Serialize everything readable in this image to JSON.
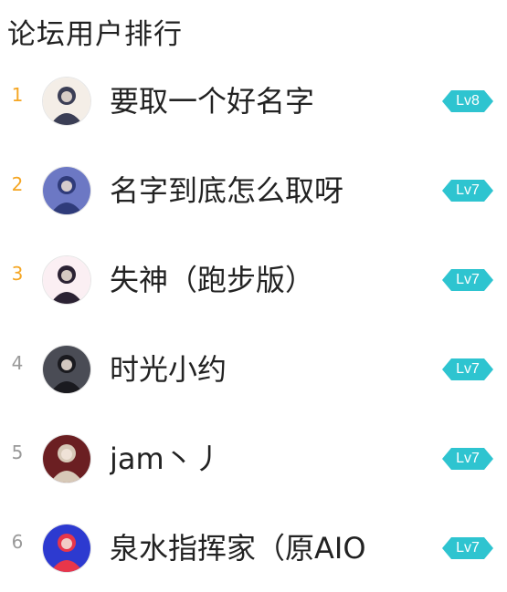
{
  "title": "论坛用户排行",
  "colors": {
    "rank_top": "#f5a623",
    "rank_other": "#999999",
    "badge": "#2ec4d0"
  },
  "users": [
    {
      "rank": "1",
      "name": "要取一个好名字",
      "level": "Lv8",
      "avatar_hue": "#3b3e55",
      "avatar_bg": "#f4eee7"
    },
    {
      "rank": "2",
      "name": "名字到底怎么取呀",
      "level": "Lv7",
      "avatar_hue": "#2f3b7a",
      "avatar_bg": "#6c78c4"
    },
    {
      "rank": "3",
      "name": "失神（跑步版）",
      "level": "Lv7",
      "avatar_hue": "#2b2233",
      "avatar_bg": "#fbeff3"
    },
    {
      "rank": "4",
      "name": "时光小约",
      "level": "Lv7",
      "avatar_hue": "#1a1a1f",
      "avatar_bg": "#4a4c55"
    },
    {
      "rank": "5",
      "name": "jam丶丿",
      "level": "Lv7",
      "avatar_hue": "#d7c9b8",
      "avatar_bg": "#6b1f22"
    },
    {
      "rank": "6",
      "name": "泉水指挥家（原AIO",
      "level": "Lv7",
      "avatar_hue": "#e8364a",
      "avatar_bg": "#2d3ad0"
    }
  ]
}
